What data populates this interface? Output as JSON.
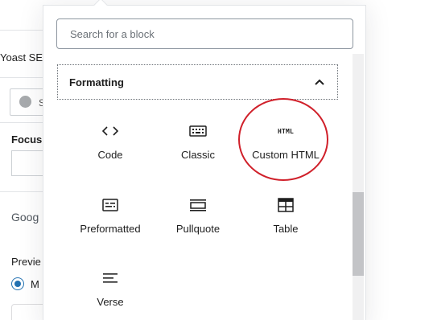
{
  "background": {
    "yoast_label": "Yoast SE",
    "radio_label_fragment": "S",
    "focus_label": "Focus",
    "google_label": "Goog",
    "preview_label": "Previe",
    "mobile_label": "M"
  },
  "inserter": {
    "search": {
      "placeholder": "Search for a block",
      "value": ""
    },
    "section": {
      "title": "Formatting",
      "expanded": true
    },
    "blocks": [
      {
        "label": "Code",
        "icon": "code-icon"
      },
      {
        "label": "Classic",
        "icon": "keyboard-icon"
      },
      {
        "label": "Custom HTML",
        "icon": "html-icon",
        "icon_text": "HTML",
        "highlighted": true
      },
      {
        "label": "Preformatted",
        "icon": "preformatted-icon"
      },
      {
        "label": "Pullquote",
        "icon": "pullquote-icon"
      },
      {
        "label": "Table",
        "icon": "table-icon"
      },
      {
        "label": "Verse",
        "icon": "verse-icon"
      }
    ]
  },
  "colors": {
    "accent": "#2271b1",
    "highlight_circle": "#d0202a",
    "border": "#e2e4e7",
    "text": "#1e1e1e"
  }
}
